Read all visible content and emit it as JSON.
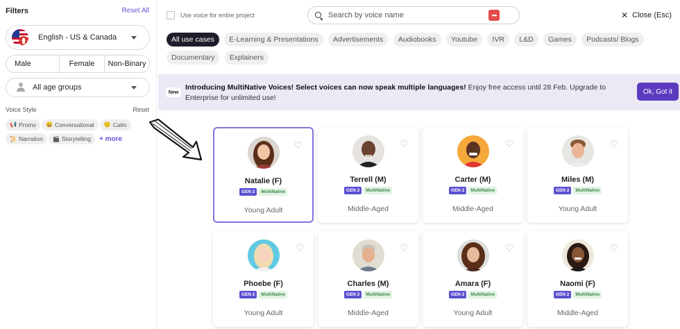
{
  "sidebar": {
    "title": "Filters",
    "reset_all": "Reset All",
    "language": "English - US & Canada",
    "genders": [
      "Male",
      "Female",
      "Non-Binary"
    ],
    "age": "All age groups",
    "voice_style_title": "Voice Style",
    "voice_style_reset": "Reset",
    "styles": [
      {
        "icon": "megaphone-icon",
        "glyph": "📢",
        "label": "Promo"
      },
      {
        "icon": "smile-icon",
        "glyph": "😀",
        "label": "Conversational"
      },
      {
        "icon": "calm-face-icon",
        "glyph": "😌",
        "label": "Calm"
      },
      {
        "icon": "scroll-icon",
        "glyph": "📜",
        "label": "Narration"
      },
      {
        "icon": "clapperboard-icon",
        "glyph": "🎬",
        "label": "Storytelling"
      }
    ],
    "more": "+ more"
  },
  "topbar": {
    "entire_project": "Use voice for entire project",
    "search_placeholder": "Search by voice name",
    "close": "Close (Esc)"
  },
  "usecases": [
    "All use cases",
    "E-Learning & Presentations",
    "Advertisements",
    "Audiobooks",
    "Youtube",
    "IVR",
    "L&D",
    "Games",
    "Podcasts/ Blogs",
    "Documentary",
    "Explainers"
  ],
  "banner": {
    "badge": "New",
    "headline": "Introducing MultiNative Voices! Select voices can now speak multiple languages!",
    "body": " Enjoy free access until 28 Feb. Upgrade to Enterprise for unlimited use!",
    "button": "Ok, Got it"
  },
  "voices": [
    {
      "name": "Natalie (F)",
      "gen": "GEN 2",
      "tag": "MultiNative",
      "age": "Young Adult"
    },
    {
      "name": "Terrell (M)",
      "gen": "GEN 2",
      "tag": "MultiNative",
      "age": "Middle-Aged"
    },
    {
      "name": "Carter (M)",
      "gen": "GEN 2",
      "tag": "MultiNative",
      "age": "Middle-Aged"
    },
    {
      "name": "Miles (M)",
      "gen": "GEN 2",
      "tag": "MultiNative",
      "age": "Young Adult"
    },
    {
      "name": "Phoebe (F)",
      "gen": "GEN 2",
      "tag": "MultiNative",
      "age": "Young Adult"
    },
    {
      "name": "Charles (M)",
      "gen": "GEN 2",
      "tag": "MultiNative",
      "age": "Middle-Aged"
    },
    {
      "name": "Amara (F)",
      "gen": "GEN 2",
      "tag": "MultiNative",
      "age": "Young Adult"
    },
    {
      "name": "Naomi (F)",
      "gen": "GEN 2",
      "tag": "MultiNative",
      "age": "Middle-Aged"
    }
  ],
  "colors": {
    "accent": "#5b3bbf",
    "selected_border": "#8a6fd8",
    "banner_bg": "#ece8f4"
  }
}
